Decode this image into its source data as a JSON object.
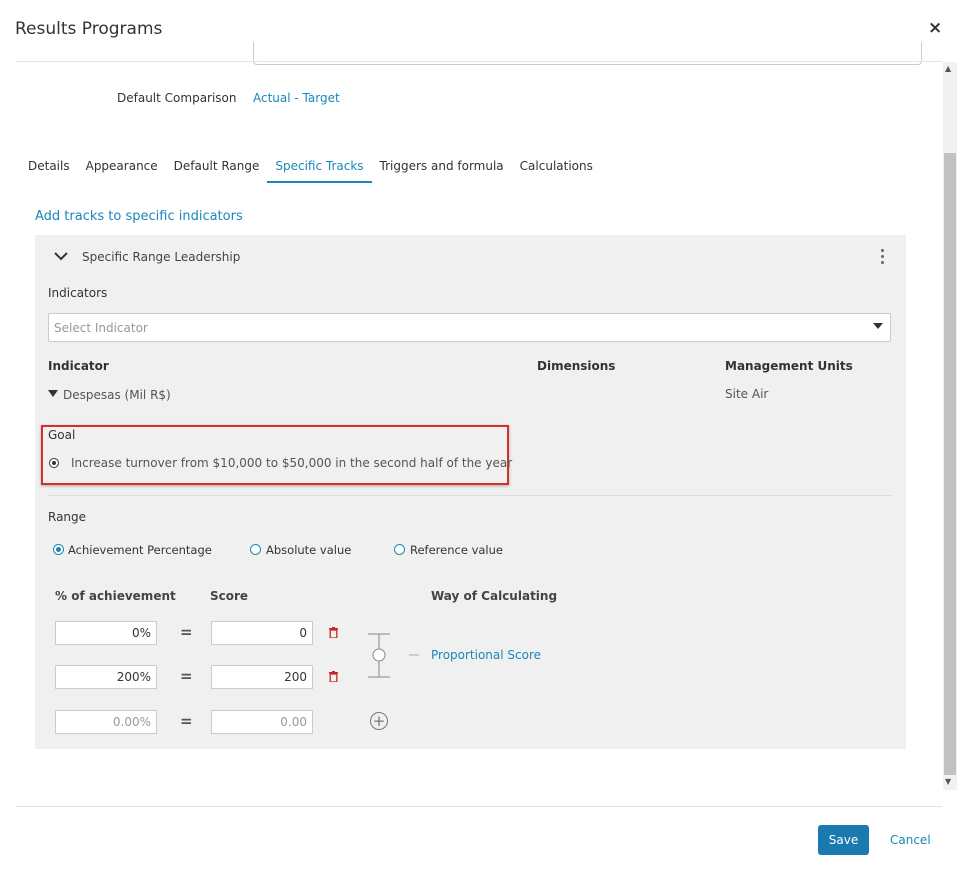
{
  "window": {
    "title": "Results Programs",
    "close": "×"
  },
  "comparison": {
    "label": "Default Comparison",
    "value": "Actual - Target"
  },
  "tabs": [
    {
      "label": "Details"
    },
    {
      "label": "Appearance"
    },
    {
      "label": "Default Range"
    },
    {
      "label": "Specific Tracks",
      "active": true
    },
    {
      "label": "Triggers and formula"
    },
    {
      "label": "Calculations"
    }
  ],
  "add_tracks_link": "Add tracks to specific indicators",
  "track": {
    "title": "Specific Range Leadership",
    "indicators_label": "Indicators",
    "select_placeholder": "Select Indicator",
    "columns": {
      "indicator": "Indicator",
      "dimensions": "Dimensions",
      "management_units": "Management Units"
    },
    "row": {
      "indicator": "Despesas (Mil R$)",
      "management_unit": "Site Air"
    },
    "goal": {
      "label": "Goal",
      "option": "Increase turnover from $10,000 to $50,000 in the second half of the year"
    },
    "range": {
      "label": "Range",
      "options": [
        {
          "label": "Achievement Percentage",
          "selected": true
        },
        {
          "label": "Absolute value",
          "selected": false
        },
        {
          "label": "Reference value",
          "selected": false
        }
      ],
      "headers": {
        "achievement": "% of achievement",
        "score": "Score",
        "way": "Way of Calculating"
      },
      "rows": [
        {
          "achievement": "0%",
          "score": "0"
        },
        {
          "achievement": "200%",
          "score": "200"
        }
      ],
      "new_row": {
        "achievement_placeholder": "0.00%",
        "score_placeholder": "0.00"
      },
      "equals": "=",
      "way_link": "Proportional Score"
    }
  },
  "footer": {
    "save": "Save",
    "cancel": "Cancel"
  },
  "colors": {
    "accent": "#1a87b8",
    "primary_button": "#1a7ab0",
    "highlight_border": "#d32f2f",
    "panel_bg": "#f0f0f0"
  }
}
